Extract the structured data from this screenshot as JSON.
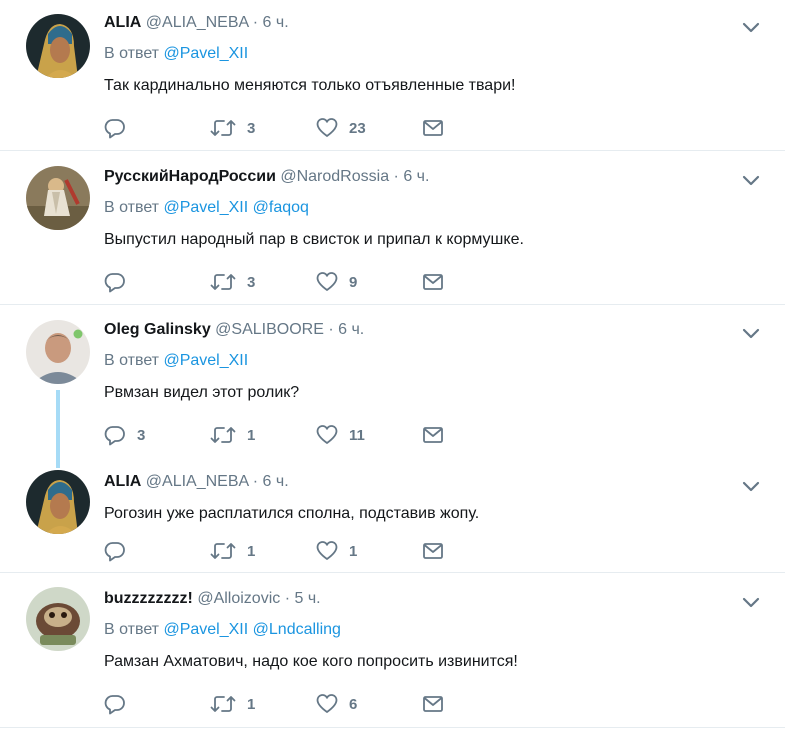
{
  "tweets": [
    {
      "name": "ALIA",
      "handle": "@ALIA_NEBA",
      "time": "6 ч.",
      "reply_prefix": "В ответ",
      "mentions": [
        "@Pavel_XII"
      ],
      "text": "Так кардинально меняются только отъявленные твари!",
      "reply_count": "",
      "retweet_count": "3",
      "like_count": "23"
    },
    {
      "name": "РусскийНародРоссии",
      "handle": "@NarodRossia",
      "time": "6 ч.",
      "reply_prefix": "В ответ",
      "mentions": [
        "@Pavel_XII",
        "@faqoq"
      ],
      "text": "Выпустил народный пар в свисток и припал к кормушке.",
      "reply_count": "",
      "retweet_count": "3",
      "like_count": "9"
    },
    {
      "name": "Oleg Galinsky",
      "handle": "@SALIBOORE",
      "time": "6 ч.",
      "reply_prefix": "В ответ",
      "mentions": [
        "@Pavel_XII"
      ],
      "text": "Рвмзан видел этот ролик?",
      "reply_count": "3",
      "retweet_count": "1",
      "like_count": "11"
    },
    {
      "name": "ALIA",
      "handle": "@ALIA_NEBA",
      "time": "6 ч.",
      "reply_prefix": "",
      "mentions": [],
      "text": "Рогозин уже расплатился сполна, подставив жопу.",
      "reply_count": "",
      "retweet_count": "1",
      "like_count": "1"
    },
    {
      "name": "buzzzzzzzz!",
      "handle": "@Alloizovic",
      "time": "5 ч.",
      "reply_prefix": "В ответ",
      "mentions": [
        "@Pavel_XII",
        "@Lndcalling"
      ],
      "text": "Рамзан Ахматович, надо кое кого попросить извинится!",
      "reply_count": "",
      "retweet_count": "1",
      "like_count": "6"
    }
  ],
  "icons": {
    "reply": "reply-icon",
    "retweet": "retweet-icon",
    "like": "heart-icon",
    "dm": "envelope-icon",
    "menu": "chevron-down-icon"
  },
  "colors": {
    "link": "#1b95e0",
    "muted": "#657786",
    "text": "#14171a",
    "thread_line": "#a6dbf6",
    "divider": "#e6ecf0"
  }
}
